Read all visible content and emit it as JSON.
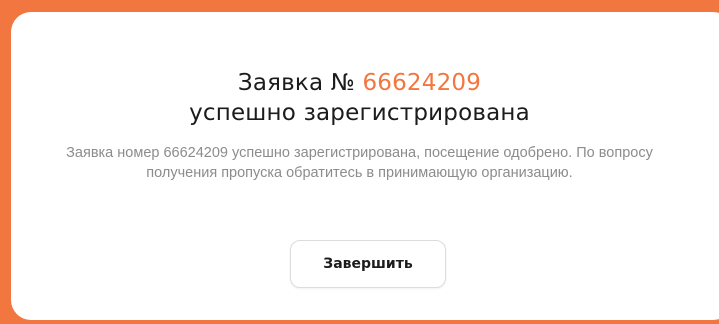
{
  "dialog": {
    "title_prefix": "Заявка № ",
    "application_number": "66624209",
    "title_suffix": "успешно зарегистрирована",
    "message": "Заявка номер 66624209 успешно зарегистрирована, посещение одобрено. По вопросу получения пропуска обратитесь в принимающую организацию.",
    "finish_label": "Завершить"
  },
  "colors": {
    "accent": "#f2763f",
    "background": "#f2763f",
    "card": "#ffffff",
    "title_text": "#1c1c1c",
    "message_text": "#8c8c8c",
    "button_border": "#dcdcdc"
  }
}
